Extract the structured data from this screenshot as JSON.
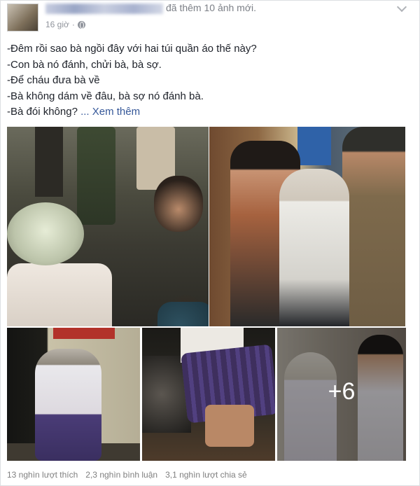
{
  "header": {
    "action_text": "đã thêm 10 ảnh mới.",
    "timestamp": "16 giờ",
    "privacy_icon": "globe-icon",
    "menu_icon": "chevron-down-icon"
  },
  "post": {
    "lines": [
      "-Đêm rồi sao bà ngồi đây với hai túi quần áo thế này?",
      "-Con bà nó đánh, chửi bà, bà sợ.",
      "-Để cháu đưa bà về",
      "-Bà không dám về đâu, bà sợ nó đánh bà.",
      "-Bà đói không?"
    ],
    "see_more": "... Xem thêm"
  },
  "photos": {
    "more_count": "+6"
  },
  "stats": {
    "likes": "13 nghìn lượt thích",
    "comments": "2,3 nghìn bình luận",
    "shares": "3,1 nghìn lượt chia sẻ"
  },
  "colors": {
    "link": "#365899",
    "meta": "#90949c",
    "text": "#1d2129"
  }
}
